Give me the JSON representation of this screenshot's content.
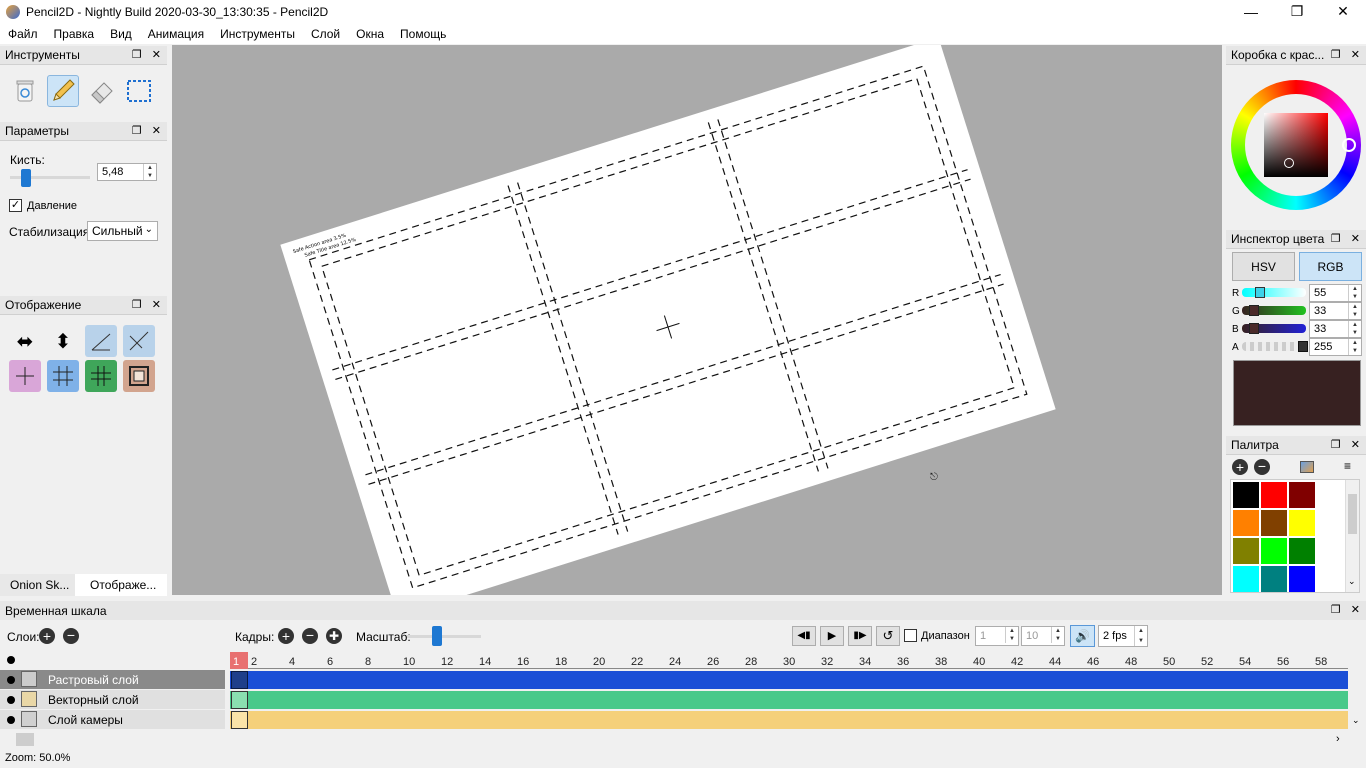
{
  "window": {
    "title": "Pencil2D - Nightly Build 2020-03-30_13:30:35 - Pencil2D"
  },
  "menu": [
    "Файл",
    "Правка",
    "Вид",
    "Анимация",
    "Инструменты",
    "Слой",
    "Окна",
    "Помощь"
  ],
  "tools_panel": {
    "title": "Инструменты"
  },
  "params_panel": {
    "title": "Параметры",
    "brush_label": "Кисть:",
    "brush_value": "5,48",
    "brush_slider_fraction": 0.2,
    "pressure_label": "Давление",
    "pressure_checked": true,
    "stabilization_label": "Стабилизация",
    "stabilization_value": "Сильный"
  },
  "display_panel": {
    "title": "Отображение"
  },
  "left_tabs": [
    "Onion Sk...",
    "Отображе..."
  ],
  "color_box": {
    "title": "Коробка с крас..."
  },
  "color_inspector": {
    "title": "Инспектор цвета",
    "tab_hsv": "HSV",
    "tab_rgb": "RGB",
    "active_tab": "RGB",
    "r_label": "R",
    "r_value": "55",
    "g_label": "G",
    "g_value": "33",
    "b_label": "B",
    "b_value": "33",
    "a_label": "A",
    "a_value": "255",
    "preview_color": "#372121"
  },
  "palette": {
    "title": "Палитра",
    "swatches": [
      "#000000",
      "#ff0000",
      "#800000",
      "#ff8000",
      "#804000",
      "#ffff00",
      "#808000",
      "#00ff00",
      "#008000",
      "#00ffff",
      "#008080",
      "#0000ff"
    ]
  },
  "timeline": {
    "title": "Временная шкала",
    "layers_label": "Слои:",
    "frames_label": "Кадры:",
    "scale_label": "Масштаб:",
    "range_label": "Диапазон",
    "range_start": "1",
    "range_end": "10",
    "fps": "2 fps",
    "current_frame": "1",
    "ticks": [
      "2",
      "4",
      "6",
      "8",
      "10",
      "12",
      "14",
      "16",
      "18",
      "20",
      "22",
      "24",
      "26",
      "28",
      "30",
      "32",
      "34",
      "36",
      "38",
      "40",
      "42",
      "44",
      "46",
      "48",
      "50",
      "52",
      "54",
      "56",
      "58"
    ],
    "layers": [
      {
        "name": "Растровый слой",
        "color": "#1b4fd6"
      },
      {
        "name": "Векторный слой",
        "color": "#49c98a"
      },
      {
        "name": "Слой камеры",
        "color": "#f5d07a"
      }
    ]
  },
  "status": {
    "zoom": "Zoom: 50.0%"
  },
  "colors": {
    "accent": "#1e78d2",
    "canvas_bg": "#aaaaaa"
  }
}
